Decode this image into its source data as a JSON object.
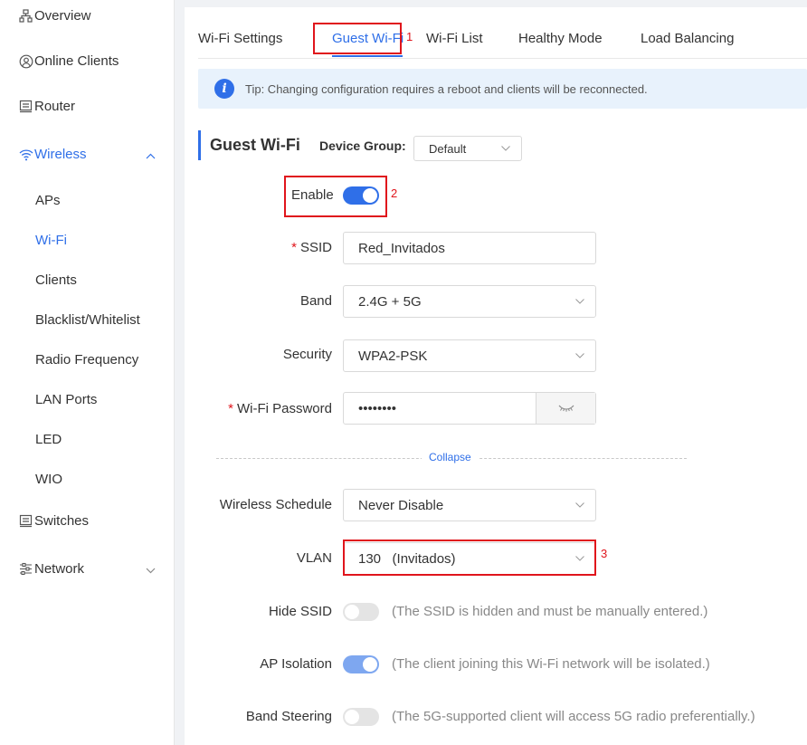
{
  "sidebar": {
    "items": [
      {
        "label": "Overview",
        "icon": "sitemap-icon"
      },
      {
        "label": "Online Clients",
        "icon": "user-circle-icon"
      },
      {
        "label": "Router",
        "icon": "router-icon"
      },
      {
        "label": "Wireless",
        "icon": "wifi-icon",
        "active": true,
        "expanded": true
      },
      {
        "label": "Switches",
        "icon": "switch-icon"
      },
      {
        "label": "Network",
        "icon": "network-icon",
        "expanded": false
      }
    ],
    "wireless_sub": [
      "APs",
      "Wi-Fi",
      "Clients",
      "Blacklist/Whitelist",
      "Radio Frequency",
      "LAN Ports",
      "LED",
      "WIO"
    ],
    "active_sub": "Wi-Fi"
  },
  "tabs": [
    "Wi-Fi Settings",
    "Guest Wi-Fi",
    "Wi-Fi List",
    "Healthy Mode",
    "Load Balancing"
  ],
  "active_tab": "Guest Wi-Fi",
  "annotations": [
    "1",
    "2",
    "3"
  ],
  "tip": "Tip: Changing configuration requires a reboot and clients will be reconnected.",
  "section": {
    "title": "Guest Wi-Fi",
    "device_group_label": "Device Group:",
    "device_group_value": "Default"
  },
  "form": {
    "enable_label": "Enable",
    "enable_on": true,
    "ssid_label": "SSID",
    "ssid_value": "Red_Invitados",
    "band_label": "Band",
    "band_value": "2.4G + 5G",
    "security_label": "Security",
    "security_value": "WPA2-PSK",
    "password_label": "Wi-Fi Password",
    "password_value": "••••••••",
    "collapse_label": "Collapse",
    "schedule_label": "Wireless Schedule",
    "schedule_value": "Never Disable",
    "vlan_label": "VLAN",
    "vlan_value": "130   (Invitados)",
    "hide_ssid_label": "Hide SSID",
    "hide_ssid_on": false,
    "hide_ssid_hint": "(The SSID is hidden and must be manually entered.)",
    "ap_isolation_label": "AP Isolation",
    "ap_isolation_on": true,
    "ap_isolation_hint": "(The client joining this Wi-Fi network will be isolated.)",
    "band_steering_label": "Band Steering",
    "band_steering_on": false,
    "band_steering_hint": "(The 5G-supported client will access 5G radio preferentially.)"
  },
  "colors": {
    "accent": "#2f6fe8",
    "highlight": "#e0151c",
    "tip_bg": "#e8f2fc"
  }
}
